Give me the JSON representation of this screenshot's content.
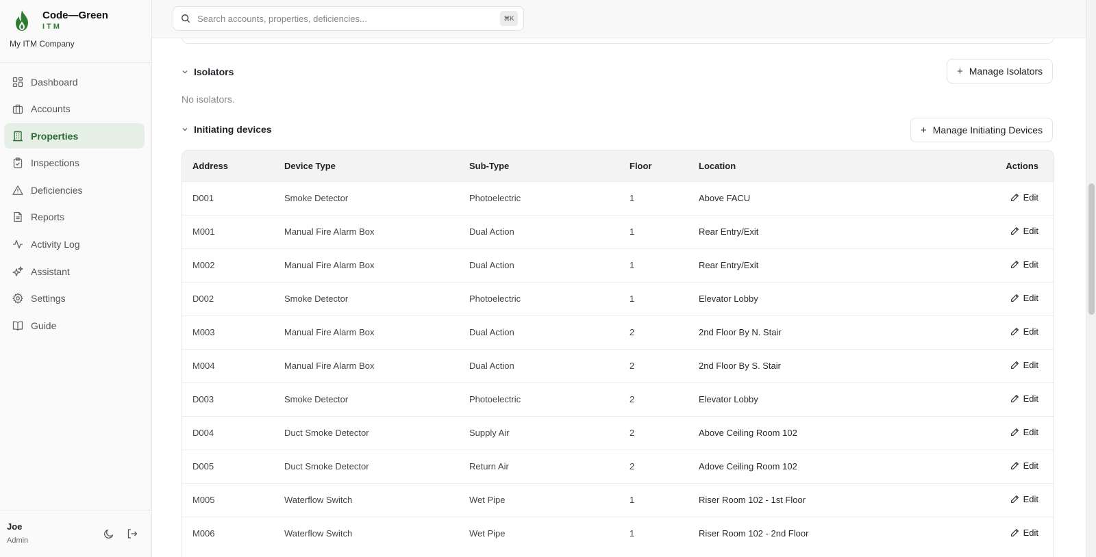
{
  "brand": {
    "name": "Code—Green",
    "sub": "ITM",
    "company": "My ITM Company"
  },
  "nav": [
    {
      "id": "dashboard",
      "label": "Dashboard",
      "icon": "dashboard-icon"
    },
    {
      "id": "accounts",
      "label": "Accounts",
      "icon": "briefcase-icon"
    },
    {
      "id": "properties",
      "label": "Properties",
      "icon": "building-icon",
      "active": true
    },
    {
      "id": "inspections",
      "label": "Inspections",
      "icon": "clipboard-check-icon"
    },
    {
      "id": "deficiencies",
      "label": "Deficiencies",
      "icon": "warning-icon"
    },
    {
      "id": "reports",
      "label": "Reports",
      "icon": "file-text-icon"
    },
    {
      "id": "activity-log",
      "label": "Activity Log",
      "icon": "activity-icon"
    },
    {
      "id": "assistant",
      "label": "Assistant",
      "icon": "sparkles-icon"
    },
    {
      "id": "settings",
      "label": "Settings",
      "icon": "gear-icon"
    },
    {
      "id": "guide",
      "label": "Guide",
      "icon": "book-icon"
    }
  ],
  "user": {
    "name": "Joe",
    "role": "Admin"
  },
  "search": {
    "placeholder": "Search accounts, properties, deficiencies...",
    "shortcut": "⌘K"
  },
  "isolators": {
    "title": "Isolators",
    "manage_label": "Manage Isolators",
    "empty_text": "No isolators."
  },
  "initiating": {
    "title": "Initiating devices",
    "manage_label": "Manage Initiating Devices",
    "columns": [
      "Address",
      "Device Type",
      "Sub-Type",
      "Floor",
      "Location",
      "Actions"
    ],
    "edit_label": "Edit",
    "rows": [
      [
        "D001",
        "Smoke Detector",
        "Photoelectric",
        "1",
        "Above FACU"
      ],
      [
        "M001",
        "Manual Fire Alarm Box",
        "Dual Action",
        "1",
        "Rear Entry/Exit"
      ],
      [
        "M002",
        "Manual Fire Alarm Box",
        "Dual Action",
        "1",
        "Rear Entry/Exit"
      ],
      [
        "D002",
        "Smoke Detector",
        "Photoelectric",
        "1",
        "Elevator Lobby"
      ],
      [
        "M003",
        "Manual Fire Alarm Box",
        "Dual Action",
        "2",
        "2nd Floor By N. Stair"
      ],
      [
        "M004",
        "Manual Fire Alarm Box",
        "Dual Action",
        "2",
        "2nd Floor By S. Stair"
      ],
      [
        "D003",
        "Smoke Detector",
        "Photoelectric",
        "2",
        "Elevator Lobby"
      ],
      [
        "D004",
        "Duct Smoke Detector",
        "Supply Air",
        "2",
        "Above Ceiling Room 102"
      ],
      [
        "D005",
        "Duct Smoke Detector",
        "Return Air",
        "2",
        "Adove Ceiling Room 102"
      ],
      [
        "M005",
        "Waterflow Switch",
        "Wet Pipe",
        "1",
        "Riser Room 102 - 1st Floor"
      ],
      [
        "M006",
        "Waterflow Switch",
        "Wet Pipe",
        "1",
        "Riser Room 102 - 2nd Floor"
      ]
    ]
  },
  "colors": {
    "brand_green": "#2f7d32",
    "active_bg": "#e6efe6",
    "active_text": "#2a6b2f"
  }
}
